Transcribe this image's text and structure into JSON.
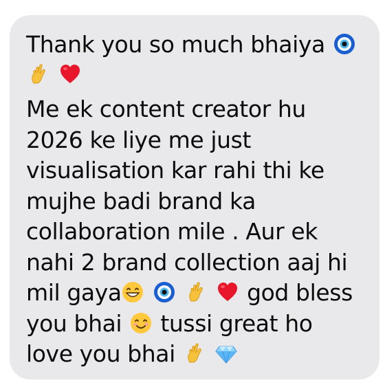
{
  "message": {
    "lines": [
      "Thank you so much bhaiya",
      "Me ek content creator hu",
      "2026 ke liye me just",
      "visualisation kar rahi thi ke",
      "mujhe badi brand ka",
      "collaboration mile . Aur ek",
      "nahi 2 brand collection aaj hi",
      "mil gaya",
      "god bless",
      "you bhai",
      "tussi great ho",
      "love you bhai"
    ],
    "emojis": {
      "line1": [
        "nazar-amulet-icon"
      ],
      "line2": [
        "crossed-fingers-icon",
        "red-heart-icon"
      ],
      "line9": [
        "grinning-face-icon",
        "nazar-amulet-icon",
        "crossed-fingers-icon",
        "red-heart-icon"
      ],
      "line10": [
        "smiling-face-icon"
      ],
      "line11": [
        "crossed-fingers-icon",
        "gem-icon"
      ]
    },
    "bubble_color": "#e9e9eb",
    "text_color": "#0b0b0b"
  }
}
